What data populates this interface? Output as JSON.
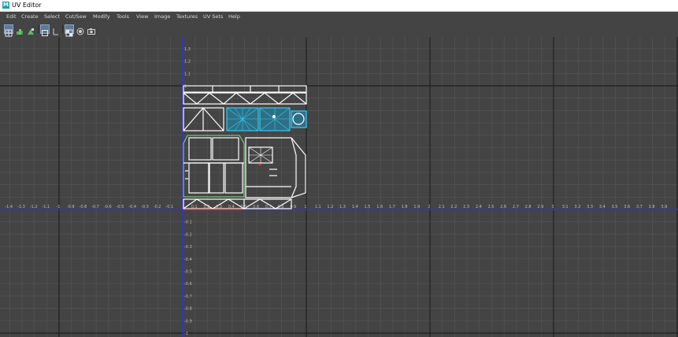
{
  "window": {
    "title": "UV Editor",
    "app_icon_letter": "M"
  },
  "menu": [
    "Edit",
    "Create",
    "Select",
    "Cut/Sew",
    "Modify",
    "Tools",
    "View",
    "Image",
    "Textures",
    "UV Sets",
    "Help"
  ],
  "toolbar": [
    "uv-grid-icon",
    "stack-icon",
    "texture-icon",
    "frame-icon",
    "pin-icon",
    "checker-icon",
    "isolate-icon",
    "snapshot-icon"
  ],
  "axes": {
    "u_negative": [
      "-1.4",
      "-1.3",
      "-1.2",
      "-1.1",
      "-1",
      "-0.9",
      "-0.8",
      "-0.7",
      "-0.6",
      "-0.5",
      "-0.4",
      "-0.3",
      "-0.2",
      "-0.1"
    ],
    "u_positive": [
      "0.1",
      "0.2",
      "0.3",
      "0.4",
      "0.5",
      "0.6",
      "0.7",
      "0.8",
      "0.9",
      "1",
      "1.1",
      "1.2",
      "1.3",
      "1.4",
      "1.5",
      "1.6",
      "1.7",
      "1.8",
      "1.9",
      "2",
      "2.1",
      "2.2",
      "2.3",
      "2.4",
      "2.5",
      "2.6",
      "2.7",
      "2.8",
      "2.9",
      "3",
      "3.1",
      "3.2",
      "3.3",
      "3.4",
      "3.5",
      "3.6",
      "3.7",
      "3.8",
      "3.9"
    ],
    "v_positive": [
      "1.3",
      "1.2",
      "1.1",
      "1"
    ],
    "v_negative": [
      "-0.1",
      "-0.2",
      "-0.3",
      "-0.4",
      "-0.5",
      "-0.6",
      "-0.7",
      "-0.8",
      "-0.9",
      "-1"
    ]
  },
  "colors": {
    "background": "#444444",
    "grid_minor": "#565656",
    "grid_major": "#1f1f1f",
    "axis": "#3434d8",
    "uv_lines": "#ffffff",
    "selected_faces": "#35c8f0",
    "border_edge": "#e23030"
  }
}
